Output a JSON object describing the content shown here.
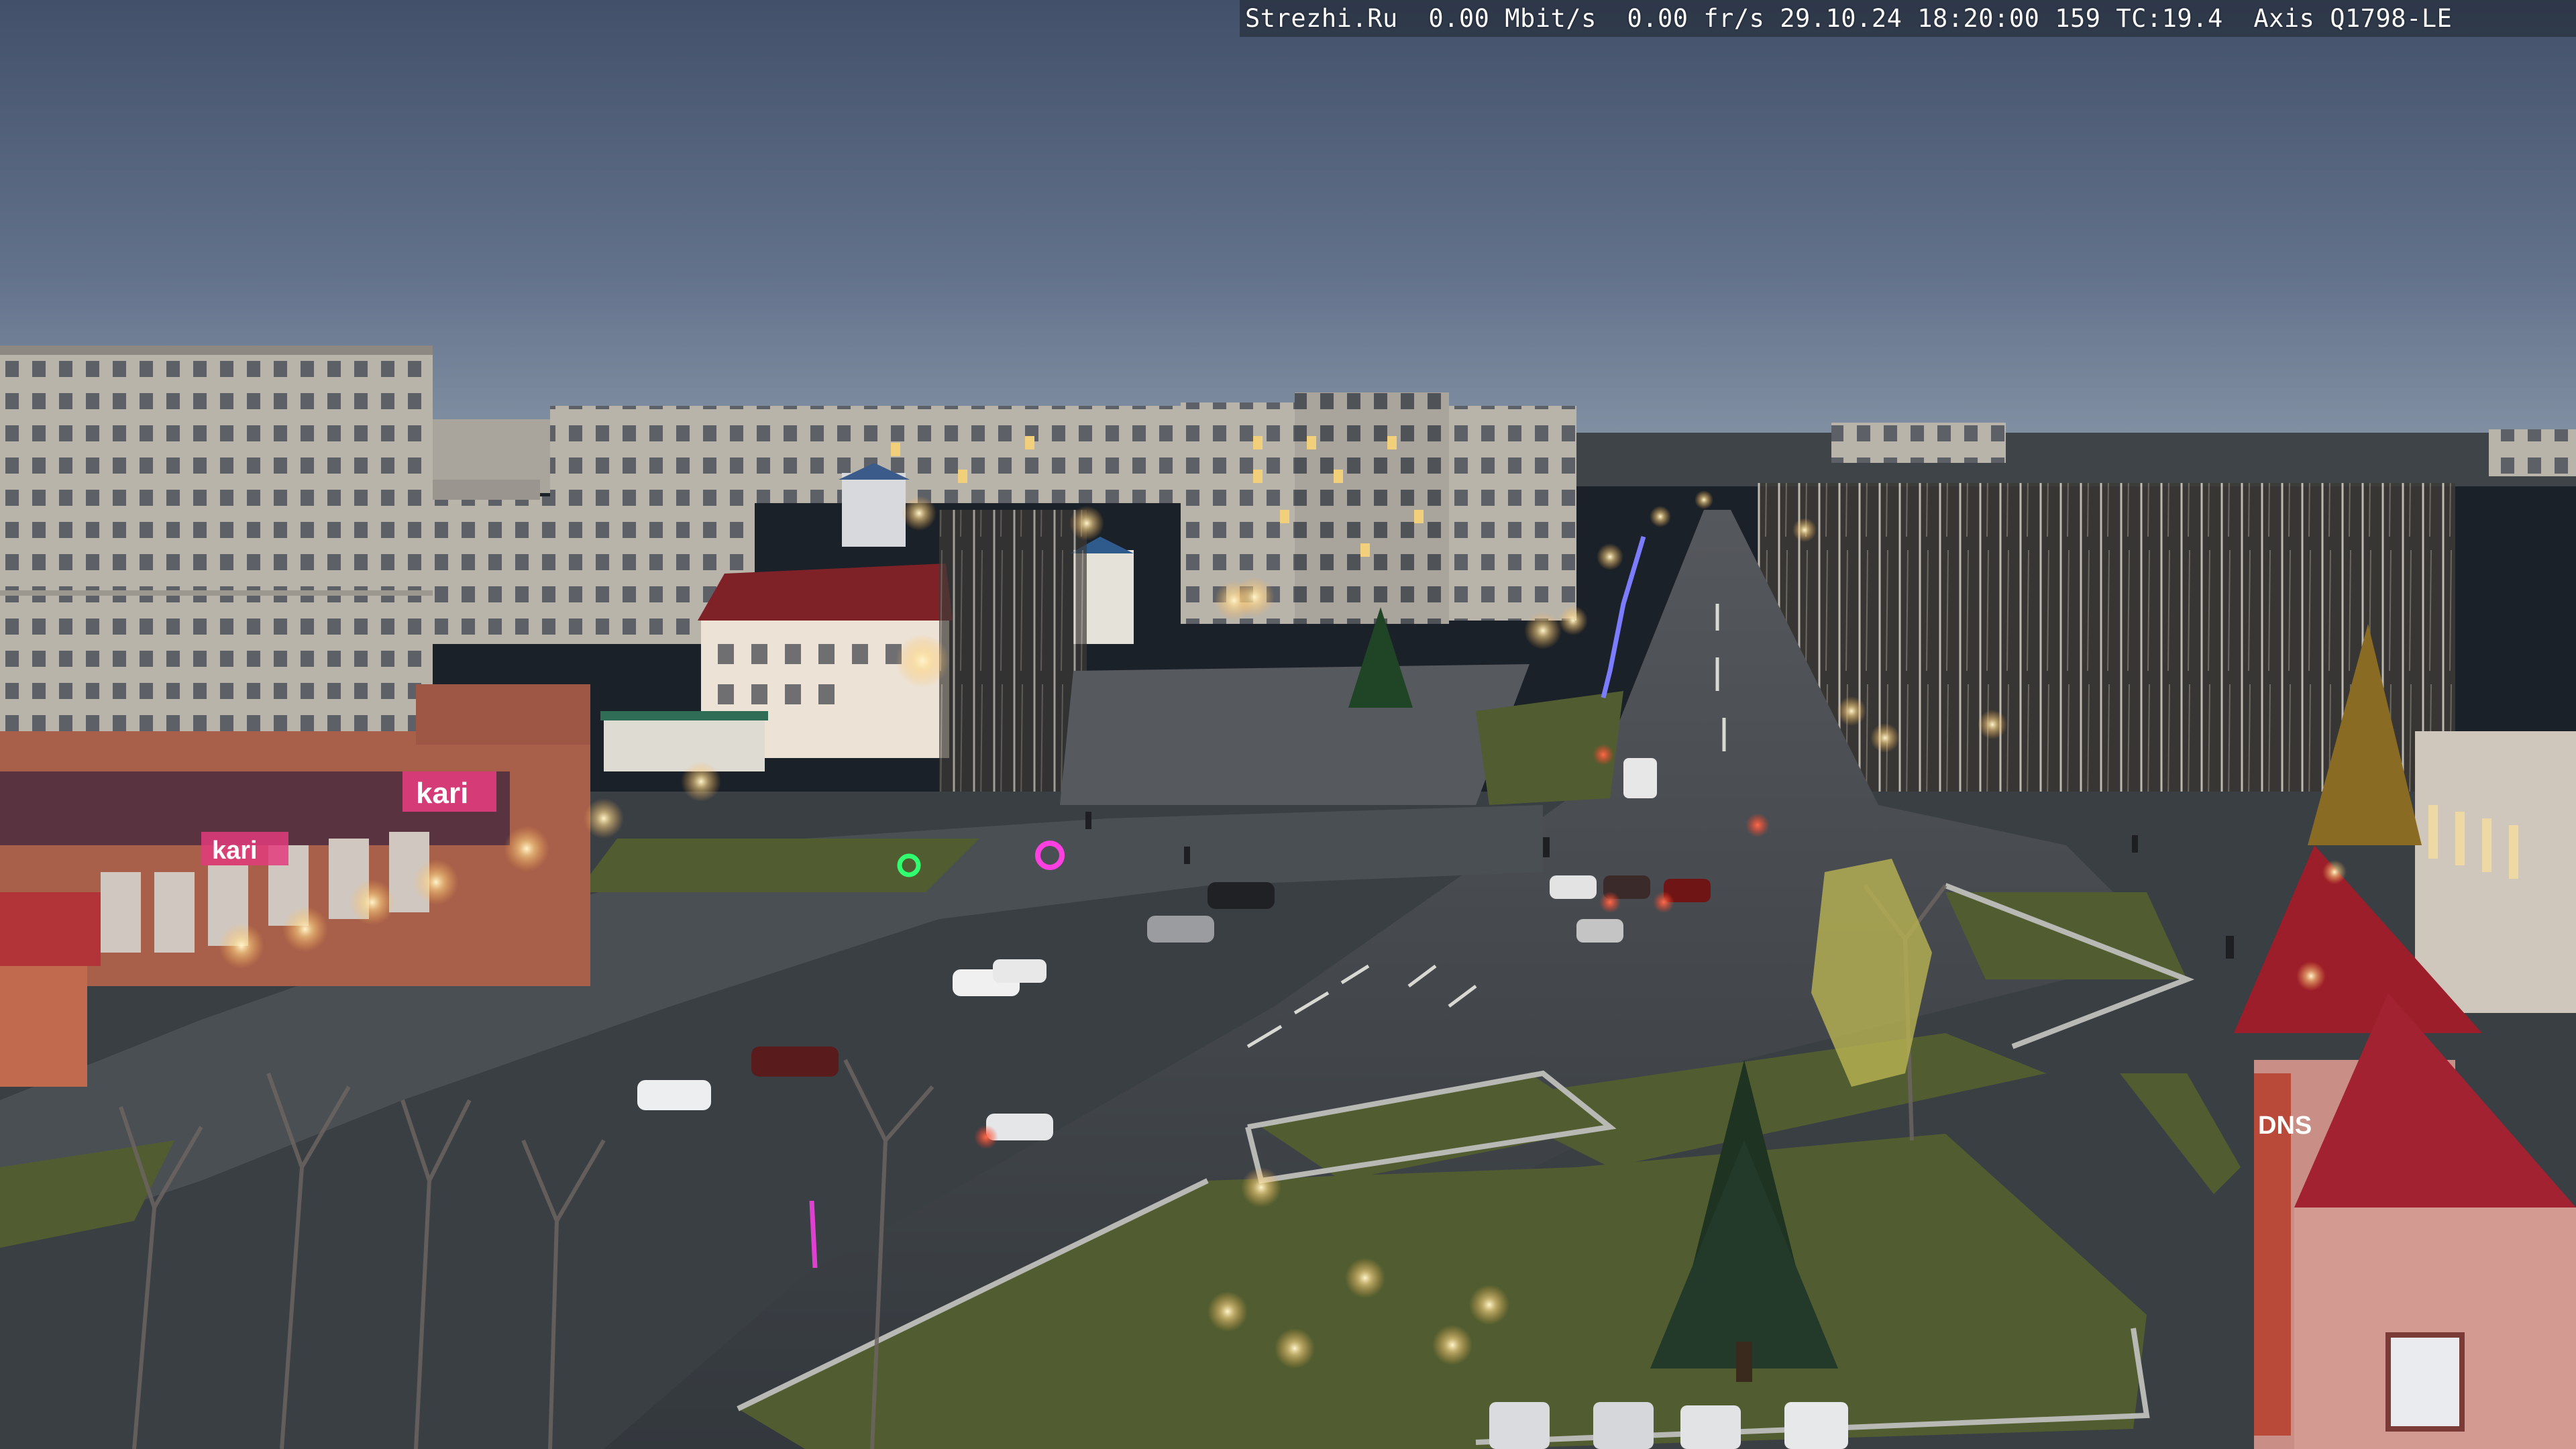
{
  "camera_overlay": {
    "site": "Strezhi.Ru",
    "bitrate": "0.00 Mbit/s",
    "framerate": "0.00 fr/s",
    "date": "29.10.24",
    "time": "18:20:00",
    "frame": "159",
    "tc": "TC:19.4",
    "model": "Axis Q1798-LE"
  },
  "signage": {
    "store_left": "kari",
    "store_left_secondary": "kari",
    "store_right": "DNS"
  },
  "colors": {
    "sky_top": "#4a5a72",
    "sky_bottom": "#7b8aa0",
    "road": "#3d4349",
    "grass": "#4f5c2e",
    "brick": "#a8604a",
    "roof_red": "#8c1f26",
    "streetlight": "#ffe9b0"
  }
}
